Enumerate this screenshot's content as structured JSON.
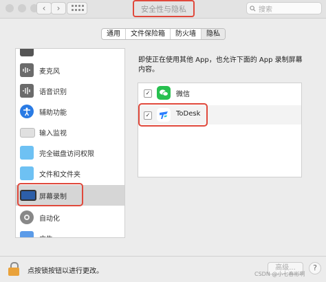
{
  "toolbar": {
    "back_icon": "‹",
    "forward_icon": "›",
    "window_title": "安全性与隐私",
    "search_placeholder": "搜索"
  },
  "tabs": [
    {
      "label": "通用",
      "active": false
    },
    {
      "label": "文件保险箱",
      "active": false
    },
    {
      "label": "防火墙",
      "active": false
    },
    {
      "label": "隐私",
      "active": true
    }
  ],
  "sidebar": {
    "items": [
      {
        "label": "",
        "icon": "partial-icon",
        "selected": false
      },
      {
        "label": "麦克风",
        "icon": "microphone-icon",
        "selected": false
      },
      {
        "label": "语音识别",
        "icon": "speech-recognition-icon",
        "selected": false
      },
      {
        "label": "辅助功能",
        "icon": "accessibility-icon",
        "selected": false
      },
      {
        "label": "输入监视",
        "icon": "keyboard-icon",
        "selected": false
      },
      {
        "label": "完全磁盘访问权限",
        "icon": "folder-icon",
        "selected": false
      },
      {
        "label": "文件和文件夹",
        "icon": "folder-icon",
        "selected": false
      },
      {
        "label": "屏幕录制",
        "icon": "display-icon",
        "selected": true
      },
      {
        "label": "自动化",
        "icon": "gear-icon",
        "selected": false
      },
      {
        "label": "广告",
        "icon": "ads-icon",
        "selected": false
      }
    ]
  },
  "main": {
    "description": "即使正在使用其他 App，也允许下面的 App 录制屏幕内容。",
    "apps": [
      {
        "name": "微信",
        "checked": true,
        "check_mark": "✓",
        "icon": "wechat-icon"
      },
      {
        "name": "ToDesk",
        "checked": true,
        "check_mark": "✓",
        "icon": "todesk-icon"
      }
    ]
  },
  "footer": {
    "lock_text": "点按锁按钮以进行更改。",
    "advanced_label": "高级...",
    "help_label": "?",
    "watermark": "CSDN @小七春彬啊"
  },
  "colors": {
    "highlight_border": "#e0483b",
    "wechat_green": "#27c04f",
    "todesk_blue": "#2b7fff"
  }
}
